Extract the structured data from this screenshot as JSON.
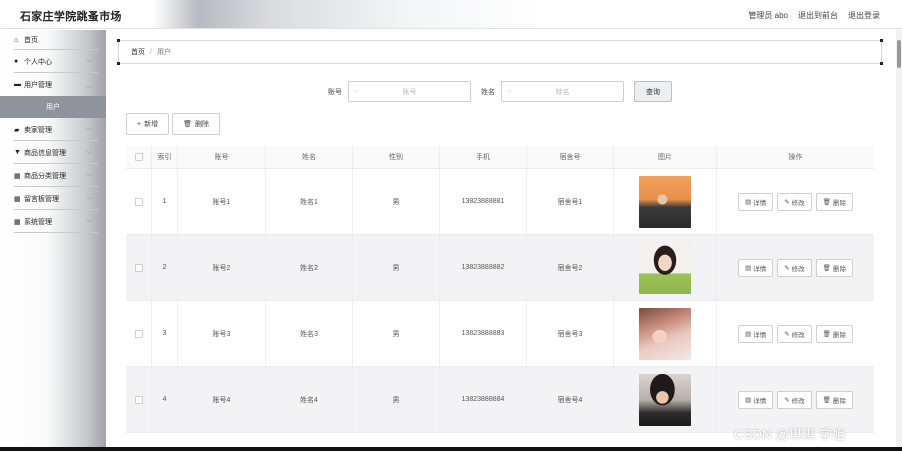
{
  "header": {
    "brand": "石家庄学院跳蚤市场",
    "admin": "管理员 abo",
    "back_frontend": "退出到前台",
    "logout": "退出登录"
  },
  "sidebar": {
    "items": [
      {
        "label": "首页",
        "icon": "home-icon"
      },
      {
        "label": "个人中心",
        "icon": "user-icon"
      },
      {
        "label": "用户管理",
        "icon": "list-icon"
      },
      {
        "label": "卖家管理",
        "icon": "seller-icon"
      },
      {
        "label": "商品信息管理",
        "icon": "goods-icon"
      },
      {
        "label": "商品分类管理",
        "icon": "grid-icon"
      },
      {
        "label": "留言板管理",
        "icon": "grid-icon"
      },
      {
        "label": "系统管理",
        "icon": "grid-icon"
      }
    ],
    "sub_active": "用户"
  },
  "breadcrumb": {
    "home": "首页",
    "sep": "/",
    "current": "用户"
  },
  "search": {
    "account_label": "账号",
    "account_placeholder": "账号",
    "name_label": "姓名",
    "name_placeholder": "姓名",
    "search_button": "查询"
  },
  "actions": {
    "add": "新增",
    "delete": "删除"
  },
  "table": {
    "headers": [
      "索引",
      "账号",
      "姓名",
      "性别",
      "手机",
      "宿舍号",
      "图片",
      "操作"
    ],
    "rows": [
      {
        "index": "1",
        "account": "账号1",
        "name": "姓名1",
        "gender": "男",
        "phone": "13823888881",
        "dorm": "宿舍号1"
      },
      {
        "index": "2",
        "account": "账号2",
        "name": "姓名2",
        "gender": "男",
        "phone": "13823888882",
        "dorm": "宿舍号2"
      },
      {
        "index": "3",
        "account": "账号3",
        "name": "姓名3",
        "gender": "男",
        "phone": "13823888883",
        "dorm": "宿舍号3"
      },
      {
        "index": "4",
        "account": "账号4",
        "name": "姓名4",
        "gender": "男",
        "phone": "13823888884",
        "dorm": "宿舍号4"
      }
    ],
    "ops": {
      "detail": "详情",
      "edit": "修改",
      "delete": "删除"
    }
  },
  "watermark": "CSDN @琪琪 学姐",
  "colors": {
    "active_menu": "#8f949c",
    "alt_row": "#f3f3f6"
  }
}
